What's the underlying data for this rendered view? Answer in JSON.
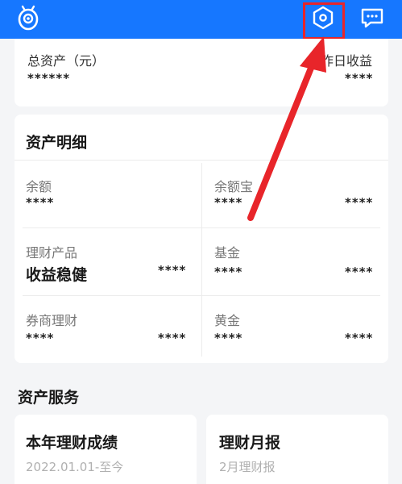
{
  "header": {
    "icons": [
      "owl-logo-icon",
      "hexagon-settings-icon",
      "chat-message-icon"
    ]
  },
  "total_assets": {
    "label": "总资产（元）",
    "value": "******",
    "yesterday_label": "昨日收益",
    "yesterday_value": "****"
  },
  "asset_detail": {
    "title": "资产明细",
    "items": [
      {
        "label": "余额",
        "value": "****",
        "value2": ""
      },
      {
        "label": "余额宝",
        "value": "****",
        "value2": "****"
      },
      {
        "label": "理财产品",
        "product": "收益稳健",
        "value": "****"
      },
      {
        "label": "基金",
        "value": "****",
        "value2": "****"
      },
      {
        "label": "券商理财",
        "value": "****",
        "value2": "****"
      },
      {
        "label": "黄金",
        "value": "****",
        "value2": "****"
      }
    ]
  },
  "services": {
    "title": "资产服务",
    "cards": [
      {
        "title": "本年理财成绩",
        "subtitle": "2022.01.01-至今"
      },
      {
        "title": "理财月报",
        "subtitle": "2月理财报"
      }
    ]
  },
  "colors": {
    "header_bg": "#1677ff",
    "highlight": "#e8252a",
    "arrow": "#e8252a"
  }
}
